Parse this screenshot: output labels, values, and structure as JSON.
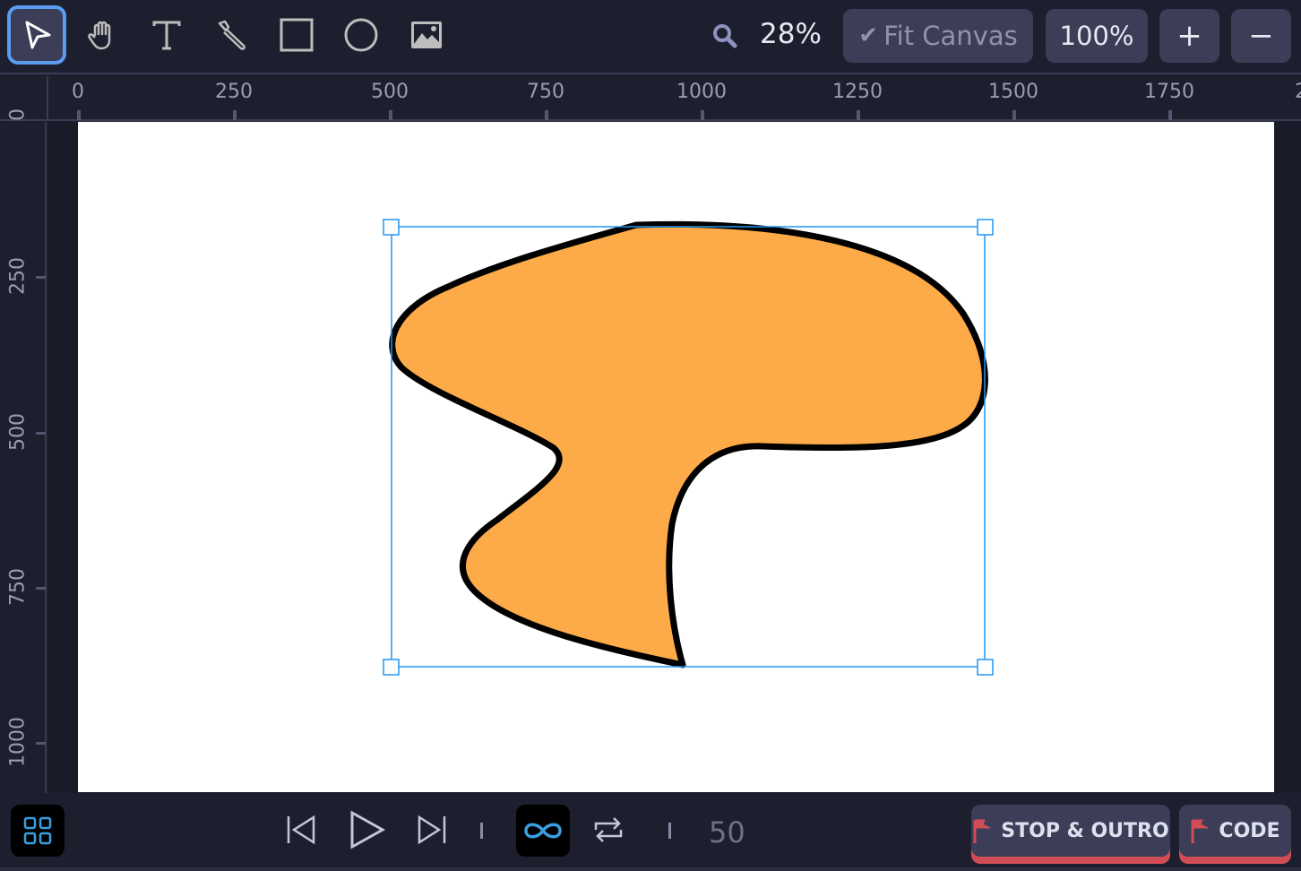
{
  "toolbar": {
    "tools": [
      {
        "name": "select",
        "active": true
      },
      {
        "name": "hand"
      },
      {
        "name": "text"
      },
      {
        "name": "pen"
      },
      {
        "name": "rectangle"
      },
      {
        "name": "ellipse"
      },
      {
        "name": "image"
      }
    ],
    "zoom_level": "28%",
    "fit_canvas_label": "Fit Canvas",
    "actual_size_label": "100%",
    "zoom_in_label": "+",
    "zoom_out_label": "−"
  },
  "rulers": {
    "horizontal": [
      "0",
      "250",
      "500",
      "750",
      "1000",
      "1250",
      "1500",
      "1750",
      "2"
    ],
    "vertical": [
      "0",
      "250",
      "500",
      "750",
      "1000"
    ]
  },
  "shape": {
    "fill": "#fcab48",
    "stroke": "#000000",
    "selection_color": "#2196f3"
  },
  "playback": {
    "frame": "50",
    "loop_active": true
  },
  "actions": {
    "stop_outro_label": "STOP & OUTRO",
    "code_label": "CODE",
    "flag_color": "#d14d55"
  }
}
